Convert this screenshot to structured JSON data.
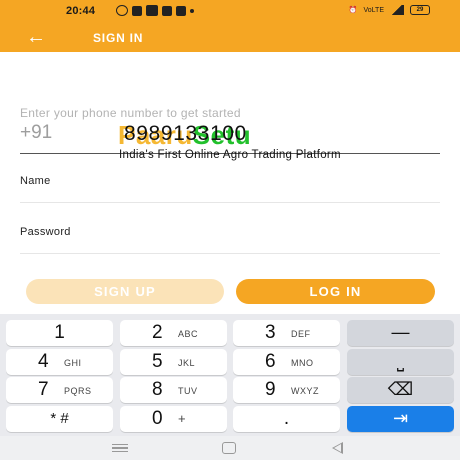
{
  "status_bar": {
    "time": "20:44",
    "notification_icons": [
      "whatsapp-icon",
      "message-icon",
      "youtube-icon",
      "play-icon",
      "sim-icon",
      "dot-icon"
    ],
    "battery": "29",
    "network": "VoLTE"
  },
  "app_bar": {
    "back_icon": "arrow-left-icon",
    "back_glyph": "←",
    "title": "SIGN IN",
    "color": "#f5a623"
  },
  "form": {
    "phone_hint": "Enter your phone number to get started",
    "country_code": "+91",
    "phone_value": "8989133100",
    "logo_part1": "Paaru",
    "logo_part2": "Setu",
    "tagline": "India's First Online Agro Trading Platform",
    "name_label": "Name",
    "password_label": "Password"
  },
  "buttons": {
    "signup": "SIGN UP",
    "login": "LOG IN"
  },
  "keyboard": {
    "row1": [
      {
        "num": "1",
        "sub": ""
      },
      {
        "num": "2",
        "sub": "ABC"
      },
      {
        "num": "3",
        "sub": "DEF"
      }
    ],
    "row2": [
      {
        "num": "4",
        "sub": "GHI"
      },
      {
        "num": "5",
        "sub": "JKL"
      },
      {
        "num": "6",
        "sub": "MNO"
      }
    ],
    "row3": [
      {
        "num": "7",
        "sub": "PQRS"
      },
      {
        "num": "8",
        "sub": "TUV"
      },
      {
        "num": "9",
        "sub": "WXYZ"
      }
    ],
    "row4": [
      {
        "num": "* #",
        "sub": ""
      },
      {
        "num": "0",
        "sub": "+"
      },
      {
        "num": ".",
        "sub": ""
      }
    ],
    "fn_keys": {
      "dash": "—",
      "space": "⎵",
      "backspace": "⌫",
      "enter": "⇥"
    },
    "enter_color": "#1a7fe8"
  },
  "nav_bar": {
    "icons": [
      "menu-icon",
      "home-icon",
      "back-triangle-icon"
    ]
  }
}
